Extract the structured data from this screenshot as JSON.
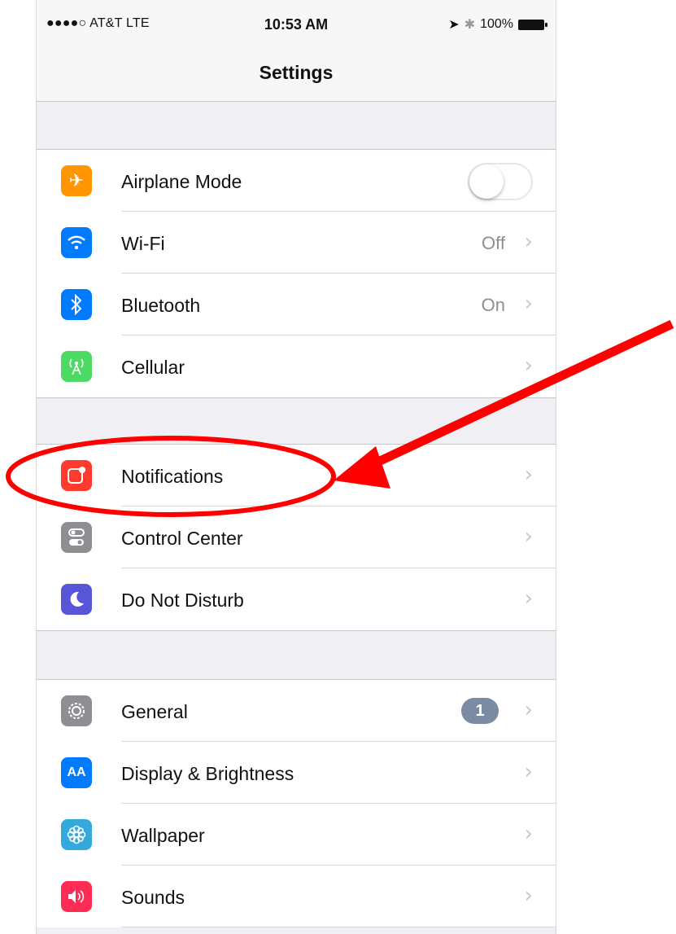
{
  "status_bar": {
    "carrier": "●●●●○ AT&T  LTE",
    "time": "10:53 AM",
    "battery": "100%"
  },
  "nav": {
    "title": "Settings"
  },
  "group1": [
    {
      "label": "Airplane Mode",
      "icon": "airplane-icon",
      "color": "#ff9500",
      "toggle": "off"
    },
    {
      "label": "Wi-Fi",
      "icon": "wifi-icon",
      "color": "#007aff",
      "value": "Off"
    },
    {
      "label": "Bluetooth",
      "icon": "bluetooth-icon",
      "color": "#007aff",
      "value": "On"
    },
    {
      "label": "Cellular",
      "icon": "cellular-icon",
      "color": "#4cd964"
    }
  ],
  "group2": [
    {
      "label": "Notifications",
      "icon": "notifications-icon",
      "color": "#ff3b30"
    },
    {
      "label": "Control Center",
      "icon": "control-center-icon",
      "color": "#8e8e93"
    },
    {
      "label": "Do Not Disturb",
      "icon": "moon-icon",
      "color": "#5856d6"
    }
  ],
  "group3": [
    {
      "label": "General",
      "icon": "gear-icon",
      "color": "#8e8e93",
      "badge": "1"
    },
    {
      "label": "Display & Brightness",
      "icon": "display-icon",
      "color": "#007aff",
      "icon_text": "AA"
    },
    {
      "label": "Wallpaper",
      "icon": "wallpaper-icon",
      "color": "#34aadc"
    },
    {
      "label": "Sounds",
      "icon": "sounds-icon",
      "color": "#ff2d55"
    }
  ],
  "chevron": "›",
  "annotation_color": "#ff0000"
}
